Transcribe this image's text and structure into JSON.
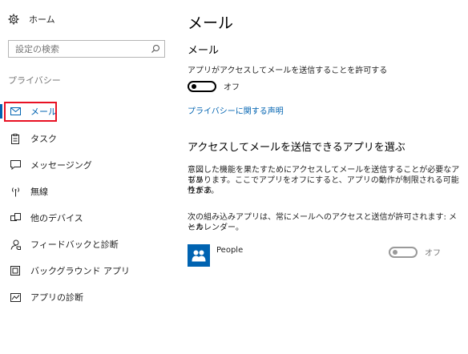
{
  "sidebar": {
    "home_label": "ホーム",
    "search_placeholder": "設定の検索",
    "section_label": "プライバシー",
    "items": [
      {
        "label": "メール",
        "icon": "mail-icon"
      },
      {
        "label": "タスク",
        "icon": "tasks-icon"
      },
      {
        "label": "メッセージング",
        "icon": "messaging-icon"
      },
      {
        "label": "無線",
        "icon": "radio-icon"
      },
      {
        "label": "他のデバイス",
        "icon": "other-devices-icon"
      },
      {
        "label": "フィードバックと診断",
        "icon": "feedback-icon"
      },
      {
        "label": "バックグラウンド アプリ",
        "icon": "background-apps-icon"
      },
      {
        "label": "アプリの診断",
        "icon": "app-diagnostics-icon"
      }
    ],
    "active_item": "メール"
  },
  "main": {
    "title": "メール",
    "subtitle": "メール",
    "allow_text": "アプリがアクセスしてメールを送信することを許可する",
    "main_toggle_state": "オフ",
    "privacy_link": "プライバシーに関する声明",
    "choose_heading": "アクセスしてメールを送信できるアプリを選ぶ",
    "desc1_line1": "意図した機能を果たすためにアクセスしてメールを送信することが必要なアプリ",
    "desc1_line2": "もあります。ここでアプリをオフにすると、アプリの動作が制限される可能性があ",
    "desc1_line3": "ります。",
    "desc2_line1": "次の組み込みアプリは、常にメールへのアクセスと送信が許可されます: メール",
    "desc2_line2": "とカレンダー。",
    "apps": [
      {
        "name": "People",
        "toggle_state": "オフ",
        "enabled": false
      }
    ]
  },
  "colors": {
    "accent": "#0063b1",
    "highlight_box": "#e81123"
  }
}
